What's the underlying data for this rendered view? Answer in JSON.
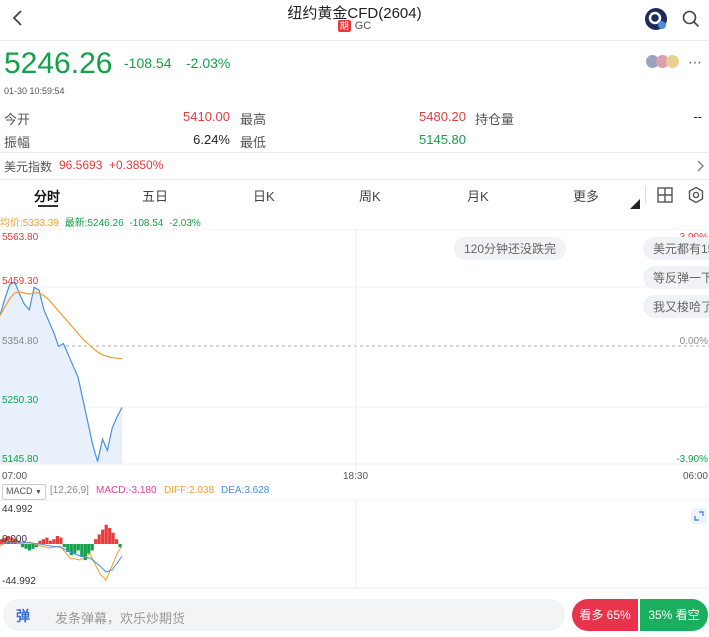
{
  "header": {
    "title": "纽约黄金CFD(2604)",
    "badge": "期",
    "code": "GC"
  },
  "quote": {
    "price": "5246.26",
    "change": "-108.54",
    "change_pct": "-2.03%",
    "time": "01-30 10:59:54"
  },
  "stats": {
    "open_label": "今开",
    "open_value": "5410.00",
    "high_label": "最高",
    "high_value": "5480.20",
    "oi_label": "持仓量",
    "oi_value": "--",
    "amp_label": "振幅",
    "amp_value": "6.24%",
    "low_label": "最低",
    "low_value": "5145.80"
  },
  "dxy": {
    "label": "美元指数",
    "value": "96.5693",
    "change": "+0.3850%"
  },
  "tabs": [
    "分时",
    "五日",
    "日K",
    "周K",
    "月K",
    "更多"
  ],
  "active_tab": "分时",
  "legend": {
    "avg": "均价:5333.39",
    "latest": "最新:5246.26",
    "change": "-108.54",
    "pct": "-2.03%"
  },
  "price_axis": {
    "top": "5563.80",
    "upper": "5459.30",
    "mid": "5354.80",
    "lower": "5250.30",
    "bottom": "5145.80",
    "pct_top": "3.90%",
    "pct_mid": "0.00%",
    "pct_bottom": "-3.90%"
  },
  "time_axis": {
    "start": "07:00",
    "middle": "18:30",
    "end": "06:00"
  },
  "chips": [
    "120分钟还没跌完",
    "美元都有15",
    "等反弹一下",
    "我又梭哈了"
  ],
  "macd": {
    "name": "MACD",
    "params": "[12,26,9]",
    "macd": "MACD:-3.180",
    "diff": "DIFF:2.038",
    "dea": "DEA:3.628",
    "top": "44.992",
    "zero": "0.000",
    "bottom": "-44.992"
  },
  "bottom": {
    "danmu_icon": "弹",
    "placeholder": "发条弹幕，欢乐炒期货",
    "bull": "看多 65%",
    "bear": "35% 看空"
  },
  "colors": {
    "green": "#14a04a",
    "red": "#e63b3b",
    "blue": "#4a8de0",
    "orange": "#f0a030",
    "pink": "#e0409a"
  },
  "chart_data": {
    "type": "line",
    "series": [
      {
        "name": "最新",
        "values": [
          5410,
          5440,
          5465,
          5470,
          5448,
          5430,
          5420,
          5460,
          5455,
          5420,
          5400,
          5380,
          5355,
          5360,
          5340,
          5320,
          5300,
          5260,
          5220,
          5180,
          5150,
          5190,
          5170,
          5210,
          5230,
          5246.26
        ]
      },
      {
        "name": "均价",
        "values": [
          5410,
          5425,
          5440,
          5450,
          5452,
          5450,
          5448,
          5450,
          5450,
          5445,
          5438,
          5428,
          5418,
          5408,
          5398,
          5388,
          5378,
          5368,
          5360,
          5352,
          5345,
          5340,
          5337,
          5335,
          5334,
          5333.39
        ]
      }
    ],
    "ylim": [
      5145.8,
      5563.8
    ]
  }
}
